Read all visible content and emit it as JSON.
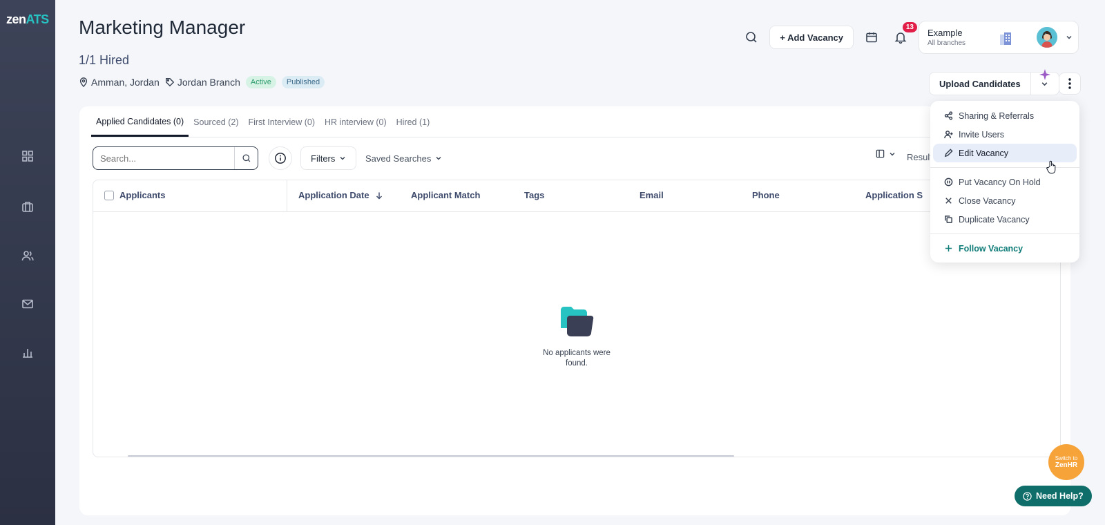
{
  "brand": {
    "name_left": "zen",
    "name_right": "ATS"
  },
  "sidebar": {
    "icons": [
      "grid-icon",
      "briefcase-icon",
      "people-icon",
      "mail-icon",
      "chart-icon"
    ]
  },
  "page": {
    "title": "Marketing Manager",
    "hired": "1/1 Hired",
    "location": "Amman, Jordan",
    "branch": "Jordan Branch",
    "status_active": "Active",
    "status_published": "Published"
  },
  "header": {
    "add_vacancy": "+ Add Vacancy",
    "notification_count": "13",
    "account_name": "Example",
    "account_sub": "All branches"
  },
  "actions": {
    "upload_candidates": "Upload Candidates"
  },
  "tabs": [
    {
      "label": "Applied Candidates (0)",
      "active": true
    },
    {
      "label": "Sourced (2)",
      "active": false
    },
    {
      "label": "First Interview (0)",
      "active": false
    },
    {
      "label": "HR interview (0)",
      "active": false
    },
    {
      "label": "Hired (1)",
      "active": false
    }
  ],
  "toolbar": {
    "search_placeholder": "Search...",
    "filters_label": "Filters",
    "saved_searches_label": "Saved Searches",
    "result_label": "Result"
  },
  "table": {
    "columns": [
      "Applicants",
      "Application Date",
      "Applicant Match",
      "Tags",
      "Email",
      "Phone",
      "Application S"
    ],
    "empty_text": "No applicants were found."
  },
  "menu": {
    "items": [
      {
        "label": "Sharing & Referrals",
        "icon": "share-icon"
      },
      {
        "label": "Invite Users",
        "icon": "user-plus-icon"
      },
      {
        "label": "Edit Vacancy",
        "icon": "pencil-icon"
      },
      {
        "label": "Put Vacancy On Hold",
        "icon": "pause-icon"
      },
      {
        "label": "Close Vacancy",
        "icon": "close-icon"
      },
      {
        "label": "Duplicate Vacancy",
        "icon": "copy-icon"
      },
      {
        "label": "Follow Vacancy",
        "icon": "plus-icon"
      }
    ]
  },
  "floating": {
    "switch_line1": "Switch to",
    "switch_line2": "ZenHR",
    "help": "Need Help?"
  },
  "colors": {
    "sidebar": "#3d4358",
    "accent": "#0f7c78",
    "badge_red": "#e11d48",
    "switch_orange": "#f6a33a"
  }
}
